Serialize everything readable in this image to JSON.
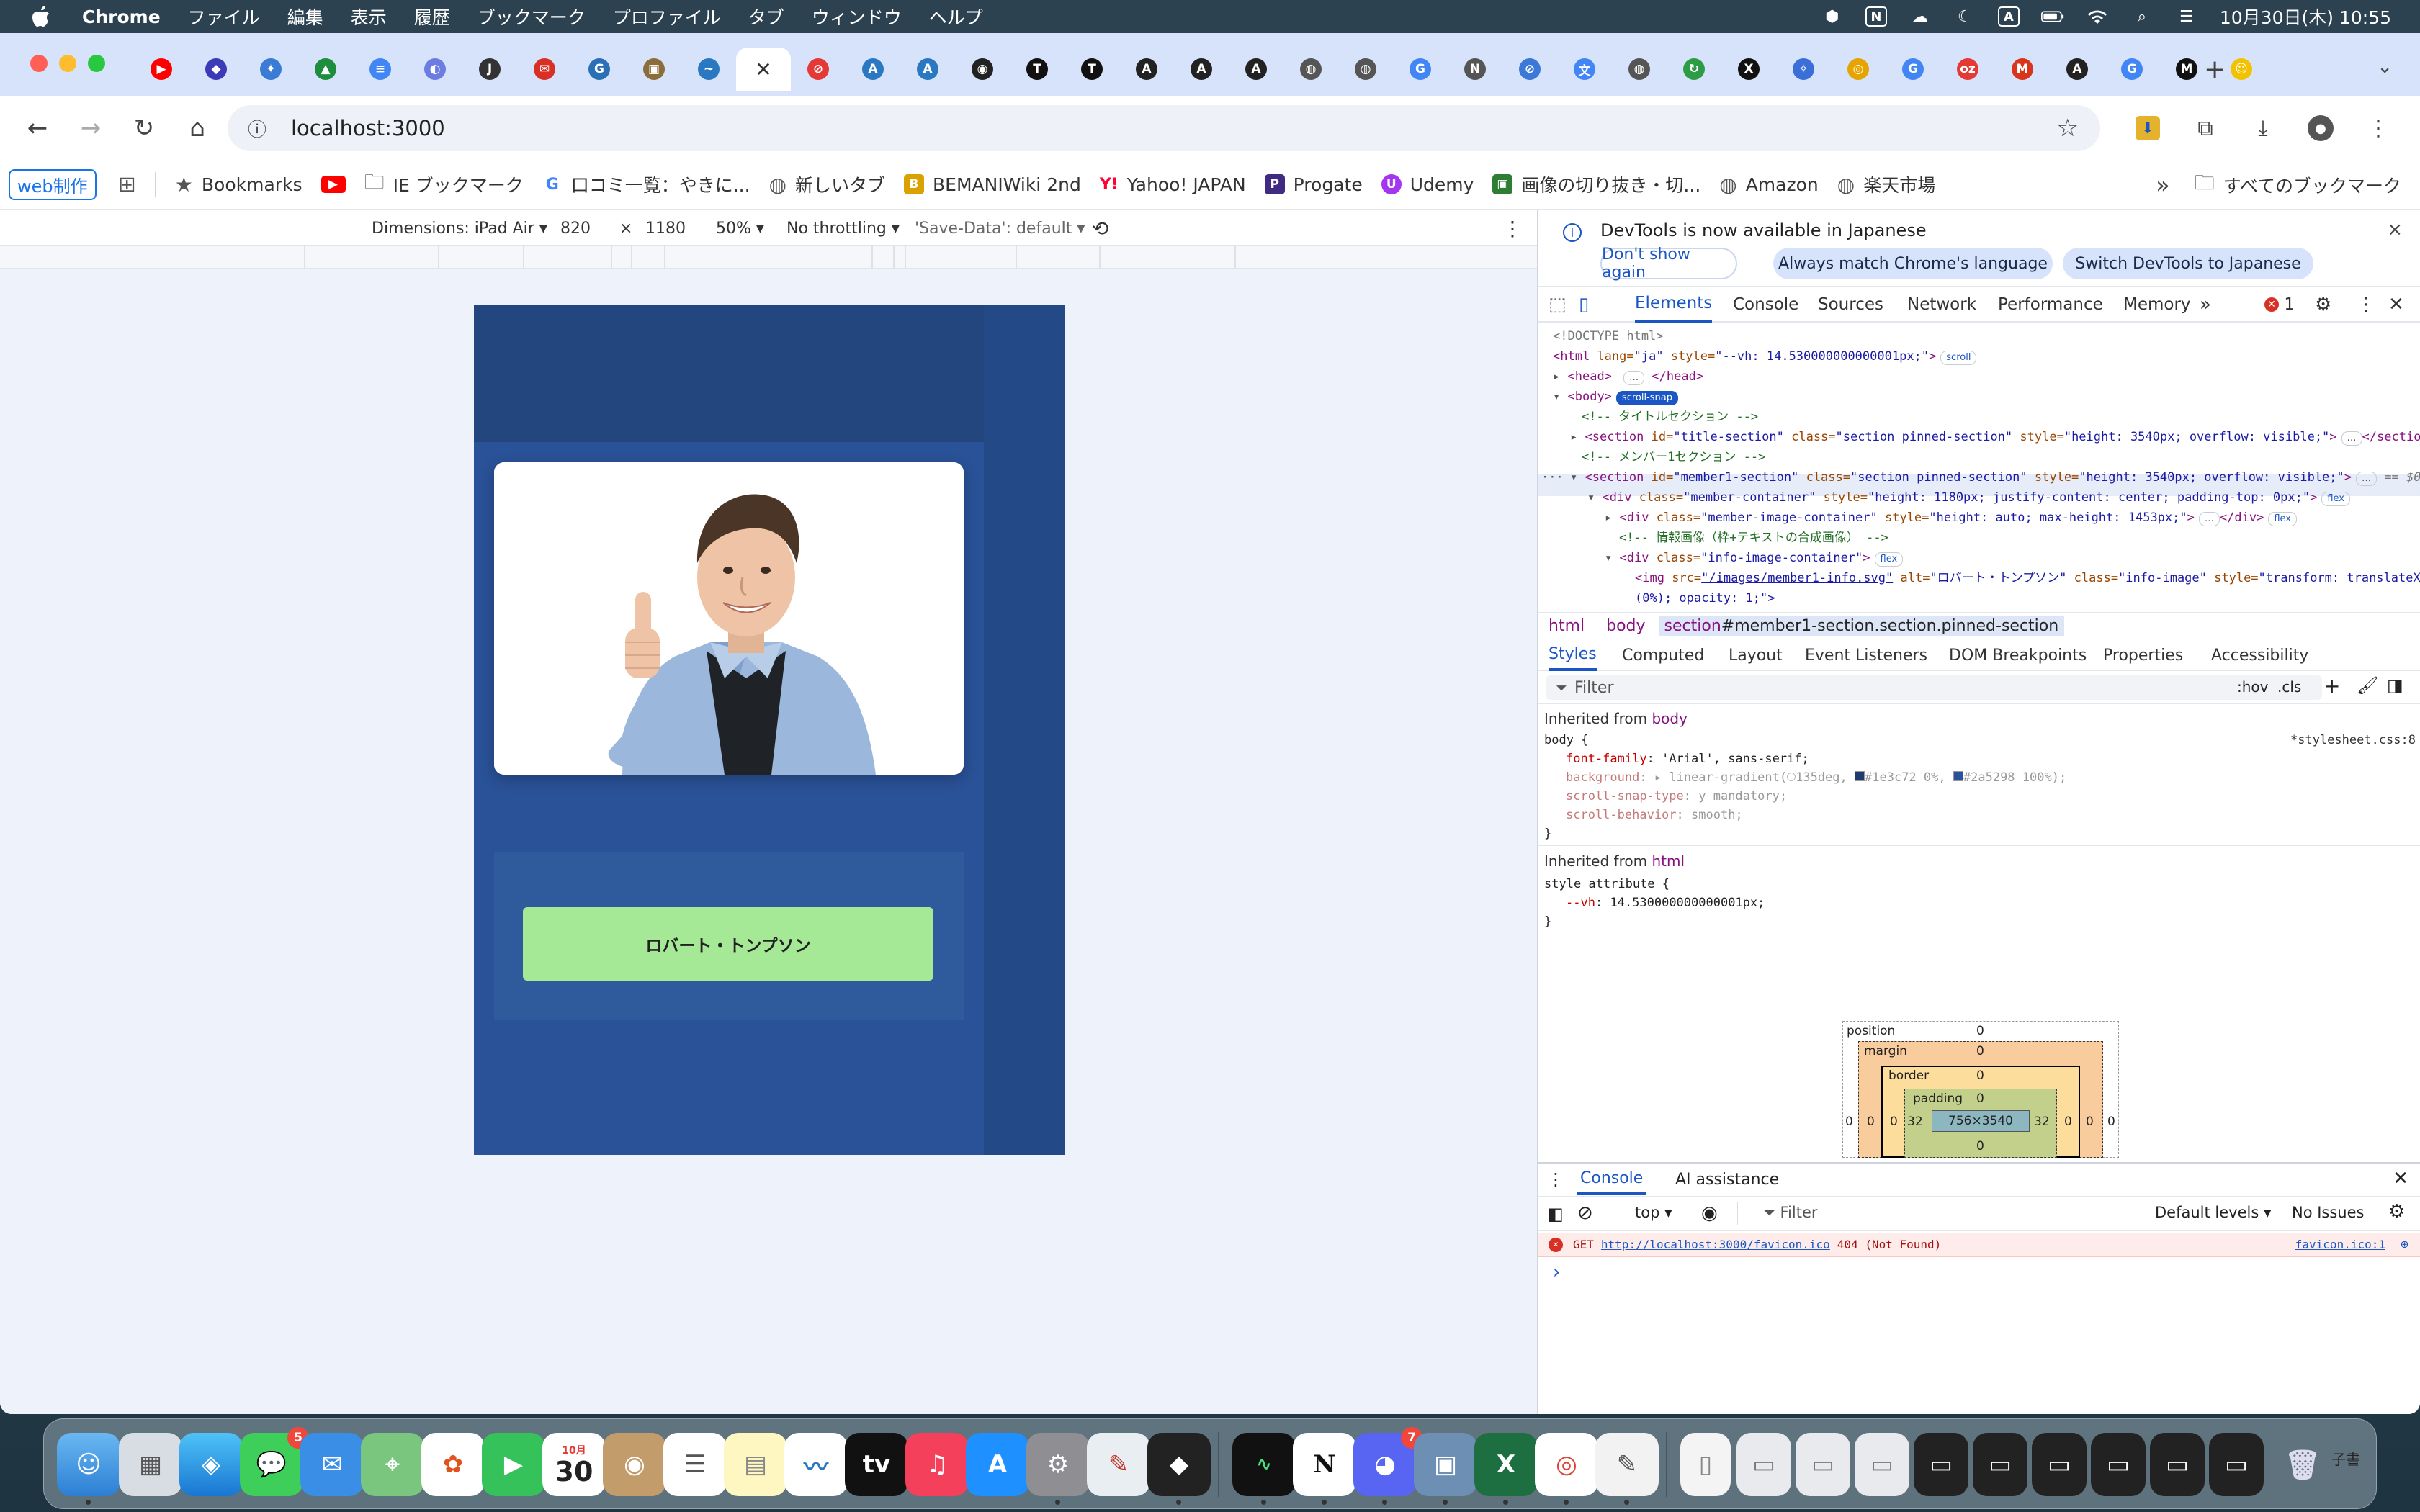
{
  "menubar": {
    "app": "Chrome",
    "items": [
      "ファイル",
      "編集",
      "表示",
      "履歴",
      "ブックマーク",
      "プロファイル",
      "タブ",
      "ウィンドウ",
      "ヘルプ"
    ],
    "status_box_n": "N",
    "status_box_a": "A",
    "datetime": "10月30日(木)  10:55"
  },
  "browser": {
    "url": "localhost:3000",
    "tabs": [
      {
        "icon": "youtube-icon",
        "color": "#ff0000"
      },
      {
        "icon": "layers-icon",
        "color": "#3b3bb8"
      },
      {
        "icon": "gemini-icon",
        "color": "#3a7bd5"
      },
      {
        "icon": "drive-icon",
        "color": "#1e8e3e"
      },
      {
        "icon": "docs-icon",
        "color": "#4285f4"
      },
      {
        "icon": "cursor-icon",
        "color": "#6b7de0"
      },
      {
        "icon": "jpux-icon",
        "color": "#333333"
      },
      {
        "icon": "mail-icon",
        "color": "#d93025"
      },
      {
        "icon": "grammar-icon",
        "color": "#2b6fb6"
      },
      {
        "icon": "photo-icon",
        "color": "#8a6d3b"
      },
      {
        "icon": "wave-icon",
        "color": "#2a78c2"
      },
      {
        "icon": "close-icon",
        "color": "#ffffff",
        "active": true
      },
      {
        "icon": "slash-icon",
        "color": "#e53935"
      },
      {
        "icon": "a-icon",
        "color": "#2a78c2"
      },
      {
        "icon": "a-icon",
        "color": "#2a78c2"
      },
      {
        "icon": "github-icon",
        "color": "#222222"
      },
      {
        "icon": "t-icon",
        "color": "#111111"
      },
      {
        "icon": "t-icon",
        "color": "#111111"
      },
      {
        "icon": "a-icon",
        "color": "#222222"
      },
      {
        "icon": "a-icon",
        "color": "#222222"
      },
      {
        "icon": "a-icon",
        "color": "#222222"
      },
      {
        "icon": "globe-icon",
        "color": "#555555"
      },
      {
        "icon": "globe-icon",
        "color": "#555555"
      },
      {
        "icon": "google-icon",
        "color": "#4285f4"
      },
      {
        "icon": "n-icon",
        "color": "#555555"
      },
      {
        "icon": "slash-icon",
        "color": "#3b78d8"
      },
      {
        "icon": "translate-icon",
        "color": "#4285f4"
      },
      {
        "icon": "globe-icon",
        "color": "#555555"
      },
      {
        "icon": "refresh-icon",
        "color": "#2e9c44"
      },
      {
        "icon": "x-icon",
        "color": "#111111"
      },
      {
        "icon": "spark-icon",
        "color": "#3b6fd8"
      },
      {
        "icon": "chrome-icon",
        "color": "#e5a400"
      },
      {
        "icon": "google-icon",
        "color": "#4285f4"
      },
      {
        "icon": "oz-icon",
        "color": "#e53935"
      },
      {
        "icon": "mario-icon",
        "color": "#d9341c"
      },
      {
        "icon": "a-icon",
        "color": "#222222"
      },
      {
        "icon": "google-icon",
        "color": "#4285f4"
      },
      {
        "icon": "m-icon",
        "color": "#111111"
      },
      {
        "icon": "face-icon",
        "color": "#f2c200"
      }
    ],
    "bookmarks": {
      "folder_label": "web制作",
      "items": [
        "Bookmarks",
        "IE ブックマーク",
        "口コミ一覧：やきに...",
        "新しいタブ",
        "BEMANIWiki 2nd",
        "Yahoo! JAPAN",
        "Progate",
        "Udemy",
        "画像の切り抜き・切...",
        "Amazon",
        "楽天市場"
      ],
      "all_bookmarks": "すべてのブックマーク"
    }
  },
  "device_toolbar": {
    "dimensions": "Dimensions: iPad Air",
    "width": "820",
    "times": "×",
    "height": "1180",
    "zoom": "50%",
    "throttling": "No throttling",
    "save_data": "'Save-Data': default"
  },
  "page": {
    "member_name": "ロバート・トンプソン"
  },
  "devtools": {
    "banner": {
      "message": "DevTools is now available in Japanese",
      "btn_dont_show": "Don't show again",
      "btn_match": "Always match Chrome's language",
      "btn_switch": "Switch DevTools to Japanese"
    },
    "tabs": [
      "Elements",
      "Console",
      "Sources",
      "Network",
      "Performance",
      "Memory"
    ],
    "error_count": "1",
    "dom": {
      "doctype": "<!DOCTYPE html>",
      "html_open_tag": "<html",
      "html_lang_attr": " lang=",
      "html_lang_val": "\"ja\"",
      "html_style_attr": " style=",
      "html_style_val": "\"--vh: 14.530000000000001px;\"",
      "html_close_bracket": ">",
      "html_badge": "scroll",
      "head": "<head>",
      "head_close": "</head>",
      "body": "<body>",
      "body_badge": "scroll-snap",
      "comment_title": "<!-- タイトルセクション -->",
      "sec1_open": "<section",
      "sec1_id_attr": " id=",
      "sec1_id_val": "\"title-section\"",
      "sec1_class_attr": " class=",
      "sec1_class_val": "\"section pinned-section\"",
      "sec1_style_attr": " style=",
      "sec1_style_val": "\"height: 3540px; overflow: visible;\"",
      "sec1_close": "</section>",
      "comment_member": "<!-- メンバー1セクション -->",
      "sec2_open": "<section",
      "sec2_id_attr": " id=",
      "sec2_id_val": "\"member1-section\"",
      "sec2_class_attr": " class=",
      "sec2_class_val": "\"section pinned-section\"",
      "sec2_style_attr": " style=",
      "sec2_style_val": "\"height: 3540px; overflow: visible;\"",
      "sec2_eq": "== $0",
      "mc_open": "<div",
      "mc_class_attr": " class=",
      "mc_class_val": "\"member-container\"",
      "mc_style_attr": " style=",
      "mc_style_val": "\"height: 1180px; justify-content: center; padding-top: 0px;\"",
      "mi_open": "<div",
      "mi_class_attr": " class=",
      "mi_class_val": "\"member-image-container\"",
      "mi_style_attr": " style=",
      "mi_style_val": "\"height: auto; max-height: 1453px;\"",
      "mi_close": "</div>",
      "comment_info": "<!-- 情報画像（枠+テキストの合成画像） -->",
      "ic_open": "<div",
      "ic_class_attr": " class=",
      "ic_class_val": "\"info-image-container\"",
      "img_open": "<img",
      "img_src_attr": " src=",
      "img_src_val": "\"/images/member1-info.svg\"",
      "img_alt_attr": " alt=",
      "img_alt_val": "\"ロバート・トンプソン\"",
      "img_class_attr": " class=",
      "img_class_val": "\"info-image\"",
      "img_style_attr": " style=",
      "img_style_val": "\"transform: translateX",
      "img_cont": "(0%); opacity: 1;\">",
      "badge_flex": "flex",
      "ellipsis": "…",
      "gutter": "···"
    },
    "breadcrumbs": [
      "html",
      "body"
    ],
    "breadcrumb_selected_tag": "section",
    "breadcrumb_selected_rest": "#member1-section.section.pinned-section",
    "subtabs": [
      "Styles",
      "Computed",
      "Layout",
      "Event Listeners",
      "DOM Breakpoints",
      "Properties",
      "Accessibility"
    ],
    "filter_placeholder": "Filter",
    "hov": ":hov",
    "cls": ".cls",
    "styles": {
      "inherited_from": "Inherited from",
      "body": "body",
      "html": "html",
      "body_rule": "body {",
      "stylesheet": "*stylesheet.css:8",
      "ff_prop": "font-family",
      "ff_val": "'Arial', sans-serif;",
      "bg_prop": "background",
      "bg_val": "linear-gradient(",
      "bg_deg": "135deg,",
      "bg_color1": "#1e3c72",
      "bg_stop1": "0%,",
      "bg_color2": "#2a5298",
      "bg_stop2": "100%);",
      "sst_prop": "scroll-snap-type",
      "sst_val": "y mandatory;",
      "sb_prop": "scroll-behavior",
      "sb_val": "smooth;",
      "style_attr": "style attribute {",
      "vh_prop": "--vh",
      "vh_val": "14.530000000000001px;",
      "close_brace": "}"
    },
    "box_model": {
      "position_label": "position",
      "margin_label": "margin",
      "border_label": "border",
      "padding_label": "padding",
      "position": "0",
      "margin": "0",
      "border": "0",
      "padding_top": "0",
      "padding_left": "32",
      "padding_right": "32",
      "padding_bottom": "0",
      "content": "756×3540",
      "side_zero": "0"
    },
    "drawer": {
      "tabs": [
        "Console",
        "AI assistance"
      ],
      "context": "top",
      "filter_placeholder": "Filter",
      "levels": "Default levels",
      "issues": "No Issues",
      "error_method": "GET",
      "error_url": "http://localhost:3000/favicon.ico",
      "error_text": "404 (Not Found)",
      "error_source": "favicon.ico:1",
      "prompt": "›"
    }
  },
  "dock": {
    "calendar_month": "10月",
    "calendar_day": "30",
    "messages_badge": "5",
    "discord_badge": "7",
    "tv_label": "tv",
    "notion_label": "N",
    "right_label": "子書"
  }
}
